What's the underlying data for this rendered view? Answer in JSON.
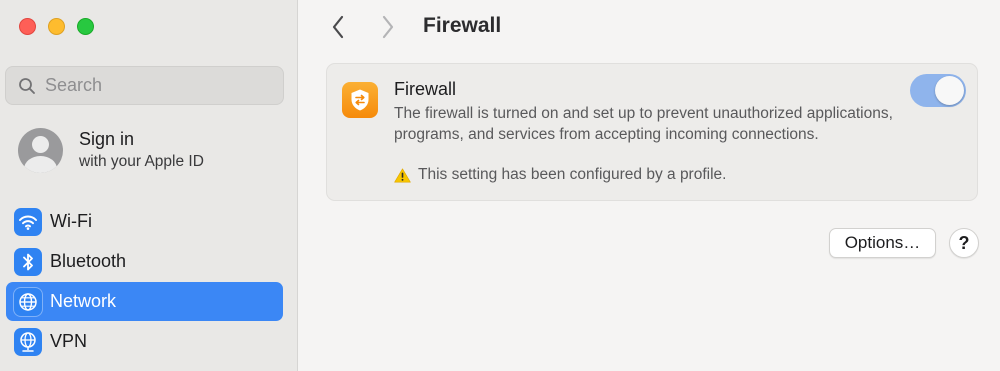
{
  "window": {
    "controls": [
      "close",
      "minimize",
      "maximize"
    ]
  },
  "sidebar": {
    "search": {
      "placeholder": "Search",
      "icon": "search-icon"
    },
    "account": {
      "title": "Sign in",
      "subtitle": "with your Apple ID",
      "icon": "user-avatar-icon"
    },
    "items": [
      {
        "label": "Wi-Fi",
        "icon": "wifi-icon",
        "active": false
      },
      {
        "label": "Bluetooth",
        "icon": "bluetooth-icon",
        "active": false
      },
      {
        "label": "Network",
        "icon": "globe-icon",
        "active": true
      },
      {
        "label": "VPN",
        "icon": "vpn-globe-icon",
        "active": false
      }
    ]
  },
  "toolbar": {
    "back_icon": "chevron-left-icon",
    "forward_icon": "chevron-right-icon",
    "title": "Firewall"
  },
  "firewall": {
    "icon": "firewall-shield-icon",
    "title": "Firewall",
    "description": "The firewall is turned on and set up to prevent unauthorized applications, programs, and services from accepting incoming connections.",
    "warning": "This setting has been configured by a profile.",
    "enabled": true
  },
  "actions": {
    "options_label": "Options…",
    "help_label": "?"
  },
  "colors": {
    "accent": "#3b87f5",
    "toggle_on_disabled": "#8fb4ec",
    "firewall_icon": "#f68a0a"
  }
}
